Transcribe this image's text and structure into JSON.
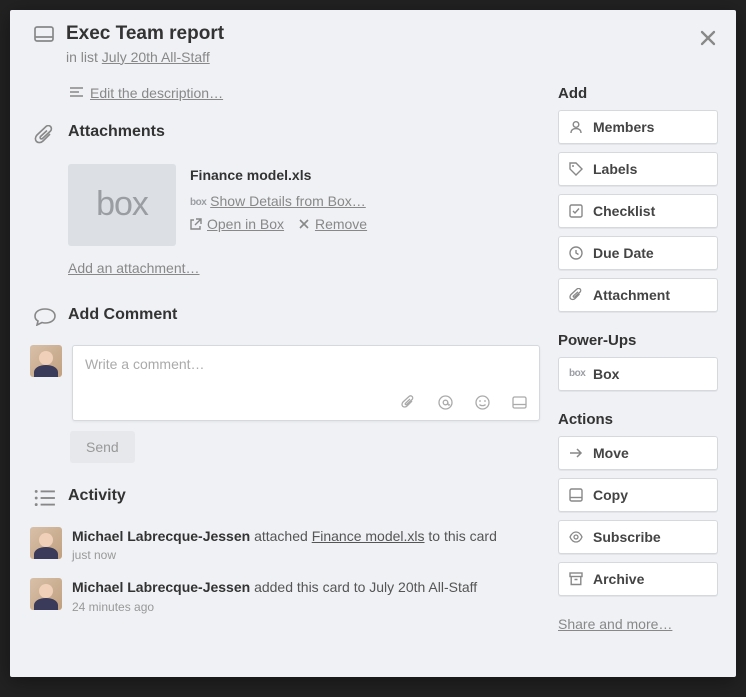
{
  "card": {
    "title": "Exec Team report",
    "in_list_prefix": "in list ",
    "list_name": "July 20th All-Staff",
    "edit_description": "Edit the description…"
  },
  "attachments": {
    "heading": "Attachments",
    "items": [
      {
        "filename": "Finance model.xls",
        "source_logo": "box",
        "show_details": "Show Details from Box…",
        "open": "Open in Box",
        "remove": "Remove"
      }
    ],
    "add": "Add an attachment…",
    "thumb_logo": "box"
  },
  "comment": {
    "heading": "Add Comment",
    "placeholder": "Write a comment…",
    "send": "Send"
  },
  "activity": {
    "heading": "Activity",
    "items": [
      {
        "actor": "Michael Labrecque-Jessen",
        "verb": " attached ",
        "object": "Finance model.xls",
        "suffix": " to this card",
        "time": "just now"
      },
      {
        "actor": "Michael Labrecque-Jessen",
        "verb": " added this card to July 20th All-Staff",
        "object": "",
        "suffix": "",
        "time": "24 minutes ago"
      }
    ]
  },
  "sidebar": {
    "add": {
      "title": "Add",
      "members": "Members",
      "labels": "Labels",
      "checklist": "Checklist",
      "due_date": "Due Date",
      "attachment": "Attachment"
    },
    "powerups": {
      "title": "Power-Ups",
      "box": "Box"
    },
    "actions": {
      "title": "Actions",
      "move": "Move",
      "copy": "Copy",
      "subscribe": "Subscribe",
      "archive": "Archive"
    },
    "share": "Share and more…"
  }
}
